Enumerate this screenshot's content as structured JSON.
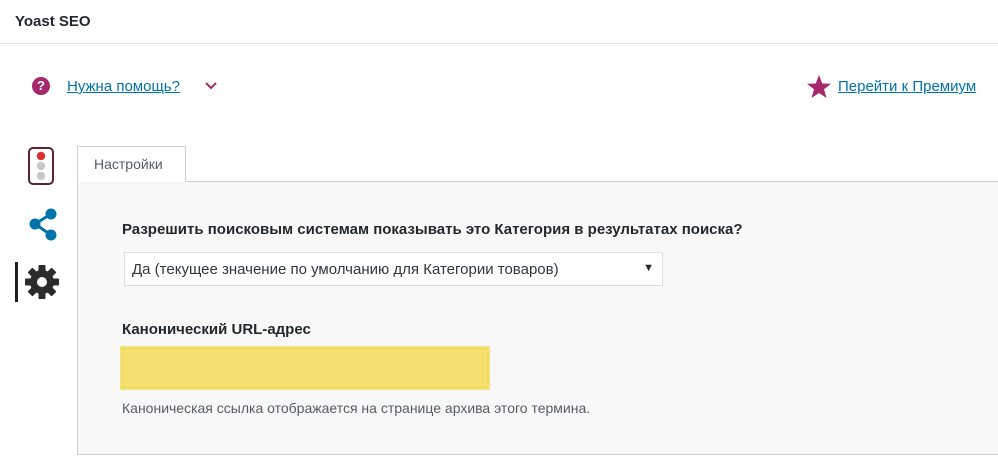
{
  "header": {
    "title": "Yoast SEO"
  },
  "help": {
    "icon": "question-circle-icon",
    "link_label": "Нужна помощь?",
    "chevron": "chevron-down-icon"
  },
  "premium": {
    "icon": "star-icon",
    "link_label": "Перейти к Премиум"
  },
  "sidebar": {
    "items": [
      {
        "icon": "traffic-light-icon",
        "name": "readability"
      },
      {
        "icon": "share-icon",
        "name": "social"
      },
      {
        "icon": "gear-icon",
        "name": "settings",
        "active": true
      }
    ]
  },
  "tabs": [
    {
      "label": "Настройки",
      "active": true
    }
  ],
  "settings": {
    "search_question": "Разрешить поисковым системам показывать это Категория в результатах поиска?",
    "search_select_value": "Да (текущее значение по умолчанию для Категории товаров)",
    "canonical_label": "Канонический URL-адрес",
    "canonical_value": "",
    "canonical_help": "Каноническая ссылка отображается на странице архива этого термина."
  },
  "colors": {
    "accent": "#a4286a",
    "link": "#0073aa",
    "highlight": "#f5df6e"
  }
}
